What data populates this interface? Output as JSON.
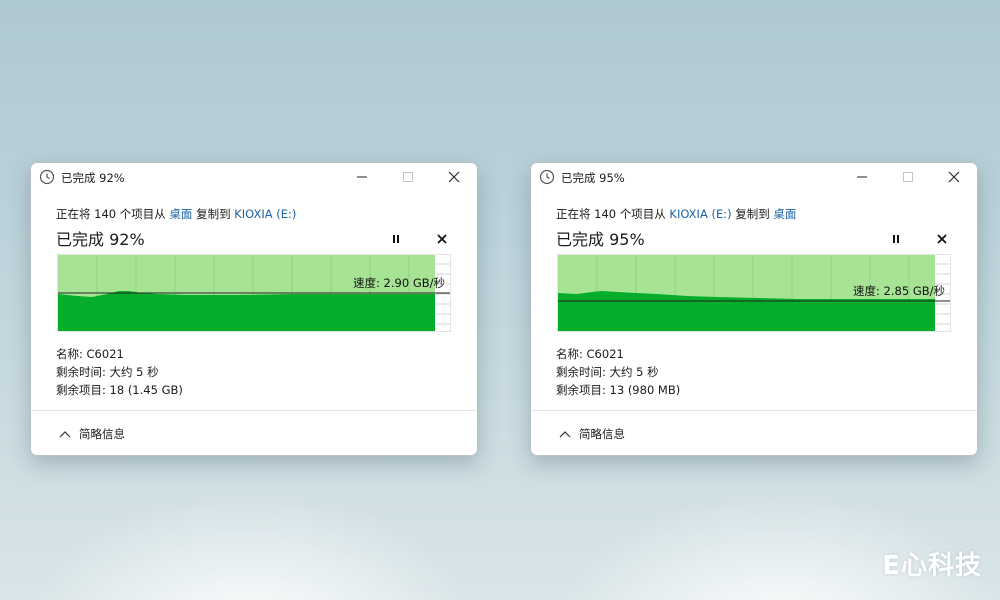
{
  "dialogs": [
    {
      "title": "已完成 92%",
      "line_prefix": "正在将 140 个项目从 ",
      "source": "桌面",
      "line_middle": " 复制到 ",
      "destination": "KIOXIA (E:)",
      "percent_label": "已完成 92%",
      "progress": 0.92,
      "speed_label": "速度: 2.90 GB/秒",
      "speed_level": 0.49,
      "name_label": "名称: C6021",
      "time_label": "剩余时间: 大约 5 秒",
      "items_label": "剩余项目: 18 (1.45 GB)",
      "footer_label": "简略信息"
    },
    {
      "title": "已完成 95%",
      "line_prefix": "正在将 140 个项目从 ",
      "source": "KIOXIA (E:)",
      "line_middle": " 复制到 ",
      "destination": "桌面",
      "percent_label": "已完成 95%",
      "progress": 0.95,
      "speed_label": "速度: 2.85 GB/秒",
      "speed_level": 0.38,
      "name_label": "名称: C6021",
      "time_label": "剩余时间: 大约 5 秒",
      "items_label": "剩余项目: 13 (980 MB)",
      "footer_label": "简略信息"
    }
  ],
  "watermark": "E心科技",
  "colors": {
    "graph_fill": "#05ae2a",
    "graph_background": "#a6e394",
    "link": "#1a62a8"
  },
  "icons": [
    "clock-icon",
    "minimize-icon",
    "maximize-icon",
    "close-icon",
    "pause-icon",
    "cancel-icon",
    "chevron-up-icon"
  ]
}
